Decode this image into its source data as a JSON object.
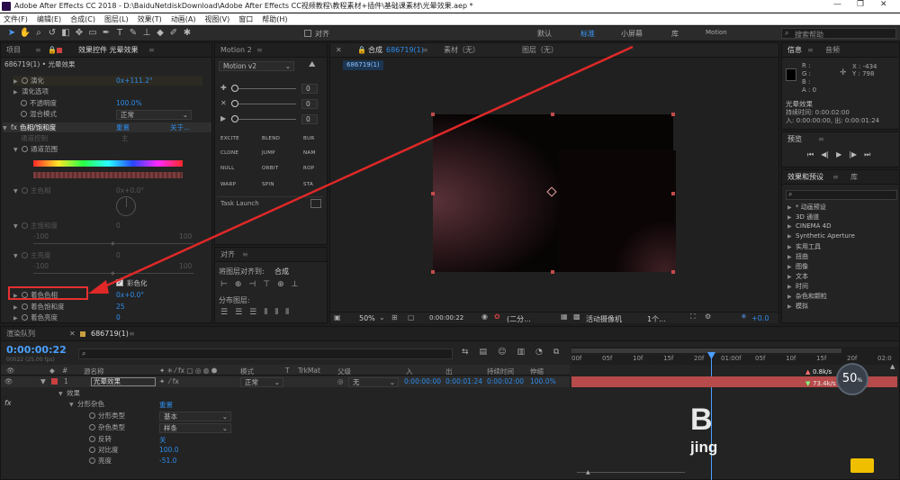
{
  "app": {
    "title": "Adobe After Effects CC 2018 - D:\\BaiduNetdiskDownload\\Adobe After Effects CC视频教程\\教程素材+插件\\基础课素材\\光晕效果.aep *"
  },
  "menu": [
    "文件(F)",
    "编辑(E)",
    "合成(C)",
    "图层(L)",
    "效果(T)",
    "动画(A)",
    "视图(V)",
    "窗口",
    "帮助(H)"
  ],
  "toolbar": {
    "snap_label": "对齐",
    "workspaces": [
      "默认",
      "标准",
      "小屏幕",
      "库",
      "Motion"
    ],
    "search_placeholder": "搜索帮助"
  },
  "project_panel": {
    "tab_project": "项目",
    "tab_effects": "效果控件 光晕效果",
    "layer_path": "686719(1) • 光晕效果",
    "props": [
      {
        "label": "演化",
        "value": "0x+111.2°"
      },
      {
        "label": "演化选项",
        "value": ""
      },
      {
        "label": "不透明度",
        "value": "100.0%"
      },
      {
        "label": "混合模式",
        "value": "正常"
      }
    ],
    "fx_name": "色相/饱和度",
    "fx_reset": "重置",
    "fx_about": "关于...",
    "channel_control": "通道控制",
    "channel_value": "主",
    "channel_range": "通道范围",
    "master_hue": "主色相",
    "master_hue_value": "0x+0.0°",
    "master_sat": "主饱和度",
    "master_sat_value": "0",
    "master_light": "主亮度",
    "master_light_value": "0",
    "neg100": "-100",
    "pos100": "100",
    "colorize_label": "彩色化",
    "colorize_hue": "着色色相",
    "colorize_hue_value": "0x+0.0°",
    "colorize_sat": "着色饱和度",
    "colorize_sat_value": "25",
    "colorize_light": "着色亮度",
    "colorize_light_value": "0"
  },
  "motion_panel": {
    "title": "Motion 2",
    "preset": "Motion v2",
    "slider_value": "0",
    "buttons": [
      "EXCITE",
      "BLEND",
      "BUR",
      "CLONE",
      "JUMP",
      "NAM",
      "NULL",
      "ORBIT",
      "ROP",
      "WARP",
      "SPIN",
      "STA"
    ],
    "task_launch": "Task Launch"
  },
  "align_panel": {
    "title": "对齐",
    "align_to_label": "将图层对齐到:",
    "align_to_value": "合成",
    "distribute": "分布图层:"
  },
  "comp_panel": {
    "tab_comp": "合成",
    "comp_name": "686719(1)",
    "tab_footage": "素材（无）",
    "tab_layer": "图层（无）",
    "crumb": "686719(1)",
    "zoom": "50%",
    "timecode": "0:00:00:22",
    "resolution": "(二分...",
    "camera": "活动摄像机",
    "views": "1个...",
    "offset": "+0.0"
  },
  "info_panel": {
    "tab_info": "信息",
    "tab_audio": "音频",
    "r": "R :",
    "g": "G :",
    "b": "B :",
    "a": "A : 0",
    "x": "X : -434",
    "y": "Y : 798",
    "layer": "光晕效果",
    "duration": "持续时间: 0:00:02:00",
    "inout": "入: 0:00:00:00, 出: 0:00:01:24"
  },
  "preview_panel": {
    "title": "预览"
  },
  "effects_presets": {
    "title": "效果和预设",
    "tab_library": "库",
    "items": [
      "* 动画预设",
      "3D 通道",
      "CINEMA 4D",
      "Synthetic Aperture",
      "实用工具",
      "扭曲",
      "图像",
      "文本",
      "时间",
      "杂色和颗粒",
      "模拟"
    ]
  },
  "timeline": {
    "tab_render": "渲染队列",
    "tab_comp": "686719(1)",
    "timecode": "0:00:00:22",
    "sub": "00022 (25.00 fps)",
    "ruler": [
      "00f",
      "05f",
      "10f",
      "15f",
      "20f",
      "01:00f",
      "05f",
      "10f",
      "15f",
      "20f",
      "02:0"
    ],
    "cols": {
      "layer_name": "源名称",
      "mode": "模式",
      "t": "T",
      "trkmat": "TrkMat",
      "parent": "父级",
      "in": "入",
      "out": "出",
      "duration": "持续时间",
      "stretch": "伸缩"
    },
    "layer": {
      "num": "1",
      "name": "光晕效果",
      "mode": "正常",
      "parent": "无",
      "in": "0:00:00:00",
      "out": "0:00:01:24",
      "duration": "0:00:02:00",
      "stretch": "100.0%"
    },
    "effects_group": "效果",
    "fx_name": "分形杂色",
    "fx_reset": "重置",
    "props": [
      {
        "label": "分形类型",
        "value": "基本"
      },
      {
        "label": "杂色类型",
        "value": "样条"
      },
      {
        "label": "反转",
        "value": "关"
      },
      {
        "label": "对比度",
        "value": "100.0"
      },
      {
        "label": "亮度",
        "value": "-51.0"
      }
    ]
  },
  "overlay": {
    "perf_percent": "50",
    "perf_unit": "%",
    "up_speed": "0.8k/s",
    "down_speed": "73.4k/s",
    "watermark": "B",
    "watermark_sub": "jing"
  }
}
